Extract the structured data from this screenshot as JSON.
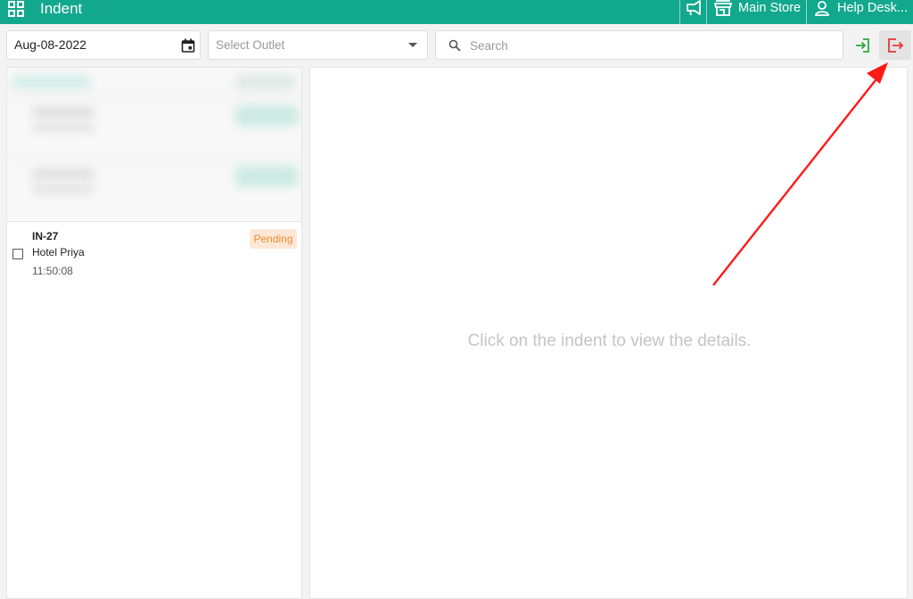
{
  "header": {
    "title": "Indent",
    "store_label": "Main Store",
    "help_label": "Help Desk...",
    "icons": {
      "menu": "grid-icon",
      "announce": "megaphone-icon",
      "store": "store-icon",
      "help": "user-icon"
    },
    "bg_color": "#12a88e"
  },
  "toolbar": {
    "date_value": "Aug-08-2022",
    "outlet_placeholder": "Select Outlet",
    "search_placeholder": "Search",
    "icons": {
      "calendar": "calendar-icon",
      "login": "login-icon",
      "logout": "logout-icon"
    },
    "login_color": "#2eaa3c",
    "logout_color": "#e53935"
  },
  "indents": [
    {
      "code": "IN-27",
      "outlet": "Hotel Priya",
      "time": "11:50:08",
      "status": "Pending"
    }
  ],
  "detail": {
    "empty_message": "Click on the indent to view the details."
  },
  "annotation": {
    "color": "#ff1a1a"
  }
}
